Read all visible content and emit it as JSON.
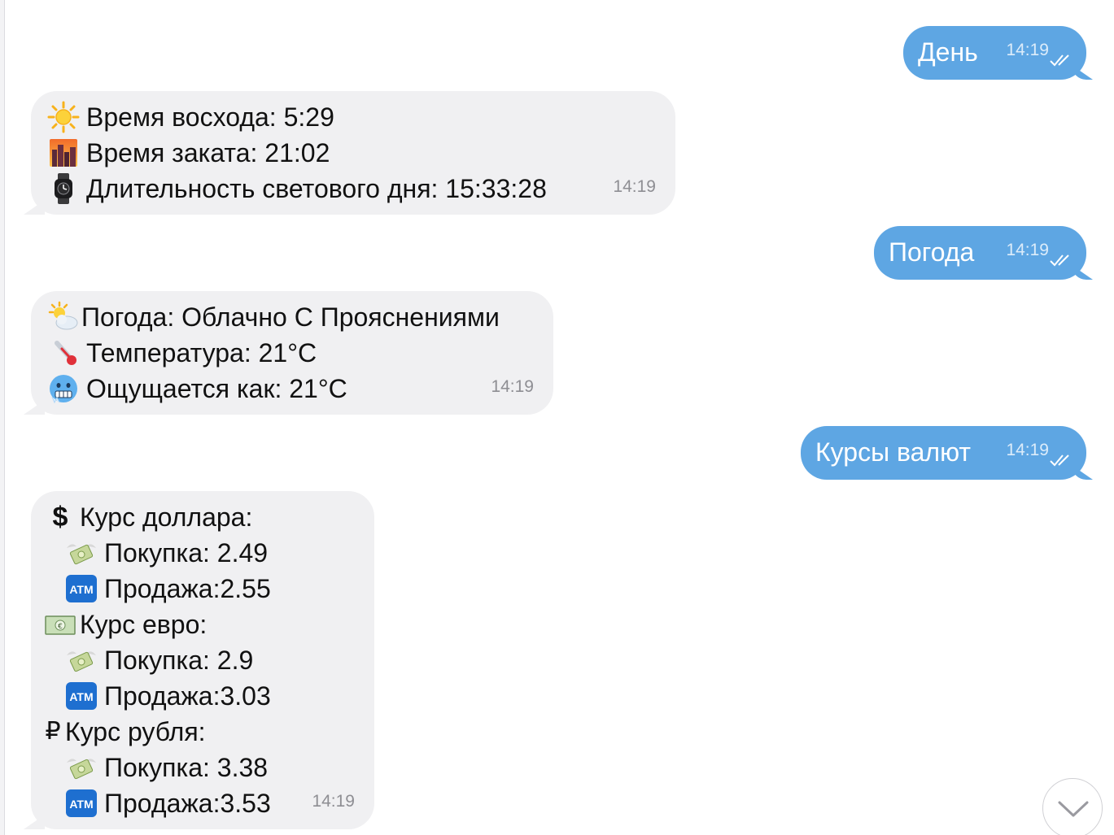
{
  "messages": [
    {
      "dir": "out",
      "text": "День",
      "time": "14:19"
    },
    {
      "dir": "in",
      "time": "14:19",
      "lines": [
        {
          "icon": "sun-icon",
          "text": "Время восхода: 5:29"
        },
        {
          "icon": "sunset-city-icon",
          "text": "Время заката: 21:02"
        },
        {
          "icon": "watch-icon",
          "text": "Длительность светового дня: 15:33:28"
        }
      ]
    },
    {
      "dir": "out",
      "text": "Погода",
      "time": "14:19"
    },
    {
      "dir": "in",
      "time": "14:19",
      "lines": [
        {
          "icon": "sun-behind-cloud-icon",
          "text": "Погода: Облачно С Прояснениями"
        },
        {
          "icon": "thermometer-icon",
          "text": "Температура: 21°C"
        },
        {
          "icon": "cold-face-icon",
          "text": "Ощущается как: 21°C"
        }
      ]
    },
    {
      "dir": "out",
      "text": "Курсы валют",
      "time": "14:19"
    },
    {
      "dir": "in",
      "time": "14:19",
      "lines": [
        {
          "icon": "dollar-sign-icon",
          "glyph": "$",
          "text": "Курс доллара:"
        },
        {
          "icon": "money-wings-icon",
          "text": "Покупка: 2.49",
          "indent": true
        },
        {
          "icon": "atm-icon",
          "text": "Продажа:2.55",
          "indent": true
        },
        {
          "icon": "euro-banknote-icon",
          "text": "Курс евро:"
        },
        {
          "icon": "money-wings-icon",
          "text": "Покупка: 2.9",
          "indent": true
        },
        {
          "icon": "atm-icon",
          "text": "Продажа:3.03",
          "indent": true
        },
        {
          "icon": "ruble-sign-icon",
          "glyph": "₽",
          "text": "Курс рубля:"
        },
        {
          "icon": "money-wings-icon",
          "text": "Покупка: 3.38",
          "indent": true
        },
        {
          "icon": "atm-icon",
          "text": "Продажа:3.53",
          "indent": true
        }
      ]
    }
  ],
  "atm_label": "ATM",
  "colors": {
    "outgoing": "#5ea6e3",
    "incoming": "#f0f0f2"
  }
}
